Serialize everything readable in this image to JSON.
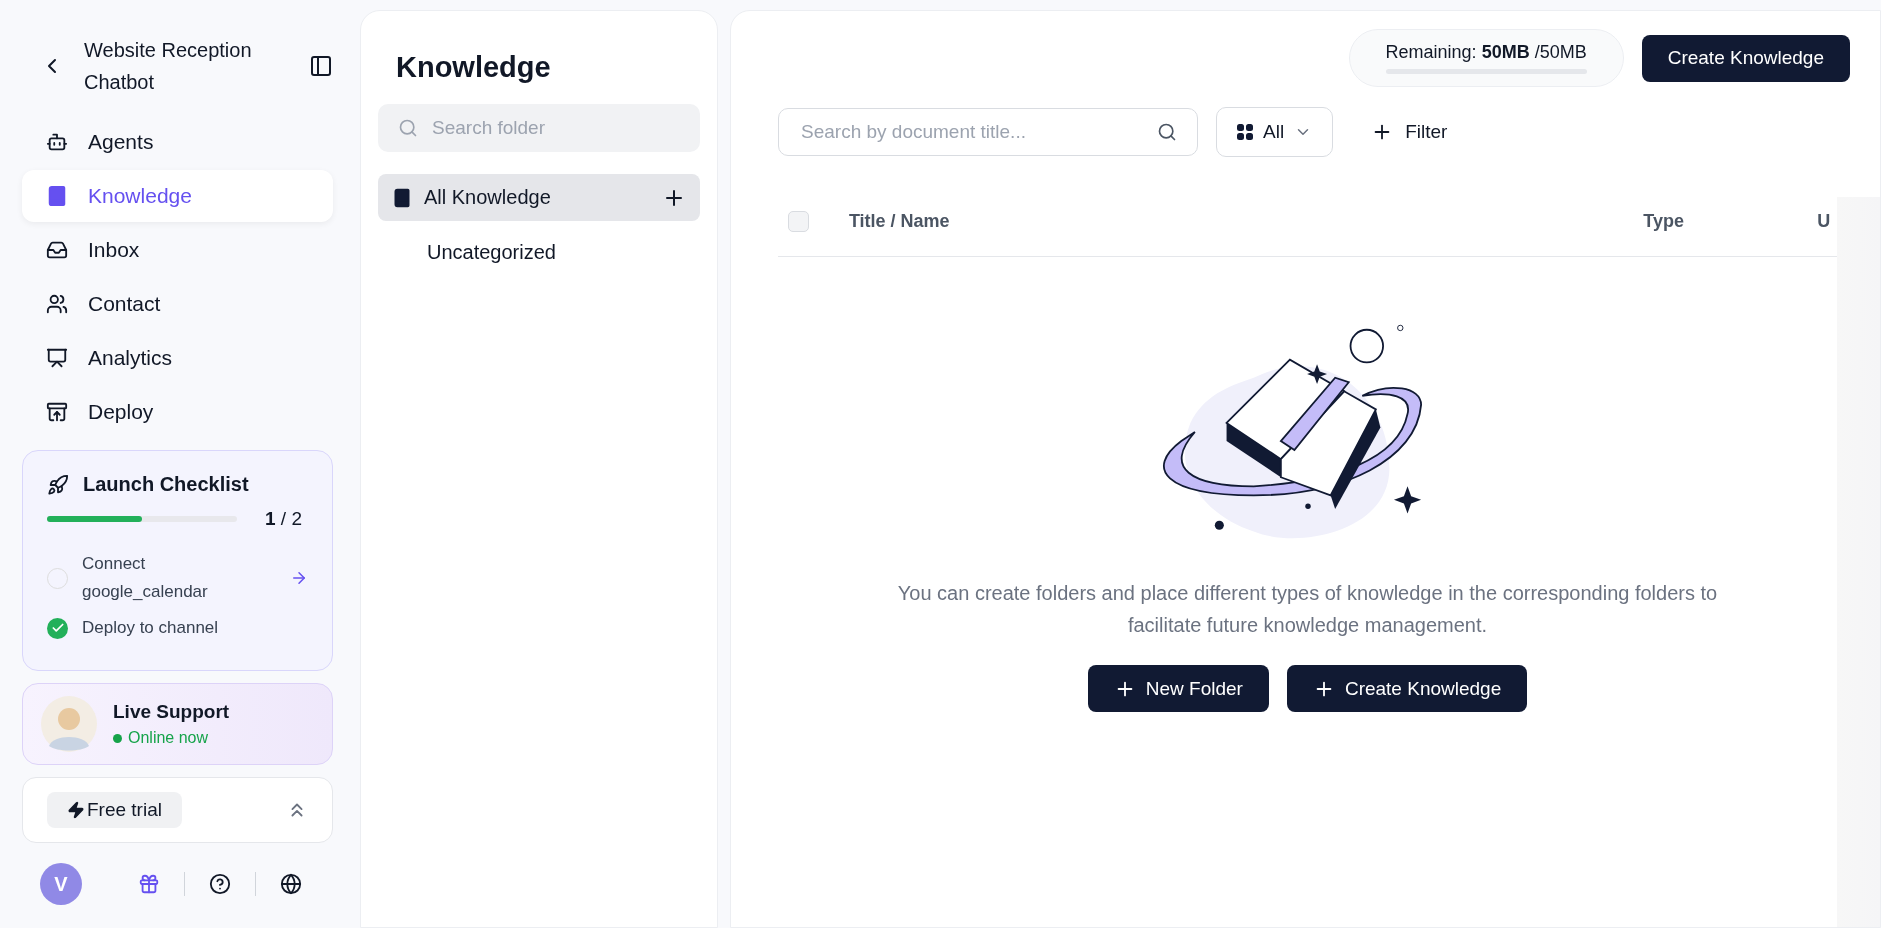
{
  "sidebar": {
    "title": "Website Reception Chatbot",
    "nav": [
      {
        "kind": "agents",
        "label": "Agents",
        "selected": false
      },
      {
        "kind": "knowledge",
        "label": "Knowledge",
        "selected": true
      },
      {
        "kind": "inbox",
        "label": "Inbox",
        "selected": false
      },
      {
        "kind": "contact",
        "label": "Contact",
        "selected": false
      },
      {
        "kind": "analytics",
        "label": "Analytics",
        "selected": false
      },
      {
        "kind": "deploy",
        "label": "Deploy",
        "selected": false
      }
    ],
    "checklist": {
      "title": "Launch Checklist",
      "level": 0.5,
      "done": "1",
      "total": "/ 2",
      "items": [
        {
          "label": "Connect google_calendar",
          "checked": false
        },
        {
          "label": "Deploy to channel",
          "checked": true
        }
      ]
    },
    "support": {
      "title": "Live Support",
      "status": "Online now"
    },
    "plan": {
      "label": "Free trial"
    },
    "avatar": "V"
  },
  "folders": {
    "title": "Knowledge",
    "search_placeholder": "Search folder",
    "items": [
      {
        "label": "All Knowledge",
        "selected": true
      },
      {
        "label": "Uncategorized",
        "selected": false
      }
    ]
  },
  "main": {
    "storage": {
      "label": "Remaining: **50MB** /50MB"
    },
    "select_all": {
      "checked": false
    },
    "create_button": "Create Knowledge",
    "search_placeholder": "Search by document title...",
    "type_filter": "All",
    "filter_button": "Filter",
    "columns": [
      "Title / Name",
      "Type",
      "U"
    ],
    "empty": {
      "message": "You can create folders and place different types of knowledge in the corresponding folders to facilitate future knowledge management.",
      "buttons": [
        "New Folder",
        "Create Knowledge"
      ]
    }
  }
}
